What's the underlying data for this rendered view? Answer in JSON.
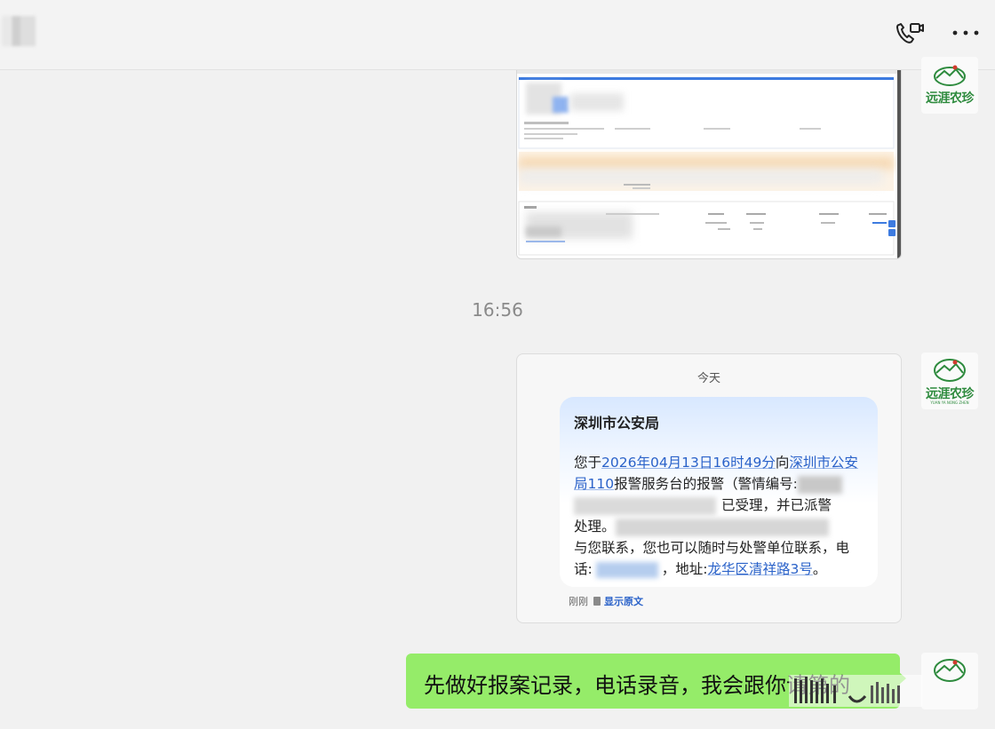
{
  "header": {
    "icons": [
      "video-call-icon",
      "more-icon"
    ]
  },
  "messages": {
    "avatar_brand": "远涯农珍",
    "avatar_sub": "YUAN YA NONG ZHEN",
    "timestamp": "16:56",
    "sms_screenshot": {
      "date_label": "今天",
      "sender": "深圳市公安局",
      "body_prefix": "您于",
      "datetime_link": "2026年04月13日16时49分",
      "to": "向",
      "org_link": "深圳市公安局110",
      "body_mid": "报警服务台的报警（警情编号:",
      "accepted": "已受理，并已派警",
      "handling": "处理。",
      "contact_line": "与您联系，您也可以随时与处警单位联系，电",
      "phone_label": "话:",
      "address_label": "，地址:",
      "address_link": "龙华区清祥路3号",
      "period": "。",
      "footer_time": "刚刚",
      "footer_action": "显示原文"
    },
    "outgoing_text": "先做好报案记录，电话录音，我会跟你请第的"
  },
  "colors": {
    "chat_bg": "#f1f1f1",
    "outgoing_bubble": "#95ec69",
    "brand_green": "#2e8b3e",
    "link_blue": "#2a62c9"
  }
}
